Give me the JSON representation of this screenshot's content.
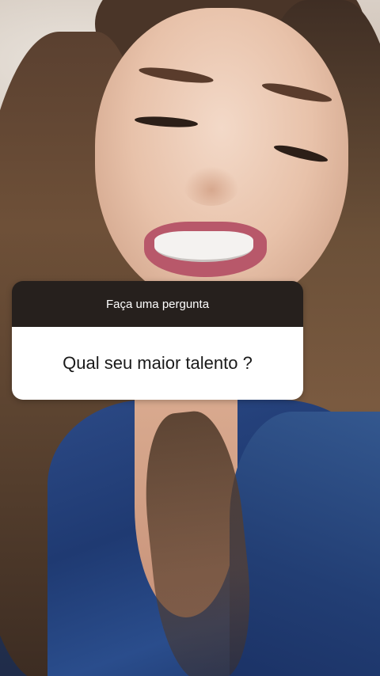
{
  "story": {
    "question_sticker": {
      "header": "Faça uma pergunta",
      "question": "Qual seu maior talento ?"
    }
  },
  "colors": {
    "sticker_header_bg": "#26201d",
    "sticker_body_bg": "#ffffff",
    "robe_blue": "#2c4a86"
  }
}
